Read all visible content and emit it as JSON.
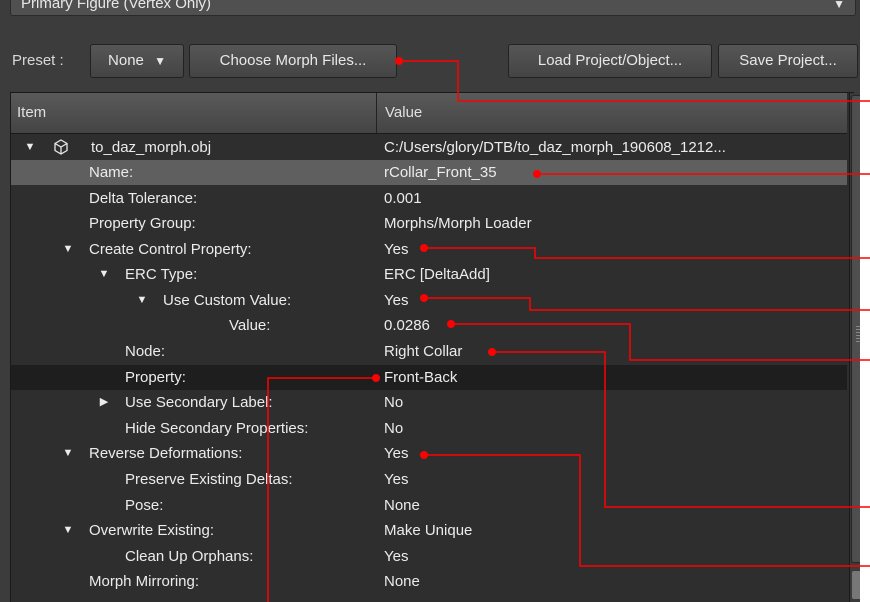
{
  "top_dropdown": {
    "value": "Primary Figure (Vertex Only)"
  },
  "preset": {
    "label": "Preset :",
    "value": "None",
    "choose_morph_files": "Choose Morph Files...",
    "load_project": "Load Project/Object...",
    "save_project": "Save Project..."
  },
  "tree": {
    "col_item": "Item",
    "col_value": "Value",
    "rows": [
      {
        "key": "to_daz_morph.obj",
        "value": "C:/Users/glory/DTB/to_daz_morph_190608_1212..."
      },
      {
        "key": "Name:",
        "value": "rCollar_Front_35"
      },
      {
        "key": "Delta Tolerance:",
        "value": "0.001"
      },
      {
        "key": "Property Group:",
        "value": "Morphs/Morph Loader"
      },
      {
        "key": "Create Control Property:",
        "value": "Yes"
      },
      {
        "key": "ERC Type:",
        "value": "ERC [DeltaAdd]"
      },
      {
        "key": "Use Custom Value:",
        "value": "Yes"
      },
      {
        "key": "Value:",
        "value": "0.0286"
      },
      {
        "key": "Node:",
        "value": "Right Collar"
      },
      {
        "key": "Property:",
        "value": "Front-Back"
      },
      {
        "key": "Use Secondary Label:",
        "value": "No"
      },
      {
        "key": "Hide Secondary Properties:",
        "value": "No"
      },
      {
        "key": "Reverse Deformations:",
        "value": "Yes"
      },
      {
        "key": "Preserve Existing Deltas:",
        "value": "Yes"
      },
      {
        "key": "Pose:",
        "value": "None"
      },
      {
        "key": "Overwrite Existing:",
        "value": "Make Unique"
      },
      {
        "key": "Clean Up Orphans:",
        "value": "Yes"
      },
      {
        "key": "Morph Mirroring:",
        "value": "None"
      }
    ]
  },
  "icons": {
    "expand": "triangle-down",
    "collapse": "triangle-right",
    "object": "cube-icon",
    "dropdown": "chevron-down-icon"
  },
  "colors": {
    "callout": "#ff0000",
    "selected_row": "#5f5f5f",
    "highlighted_row": "#1e1e1e"
  }
}
